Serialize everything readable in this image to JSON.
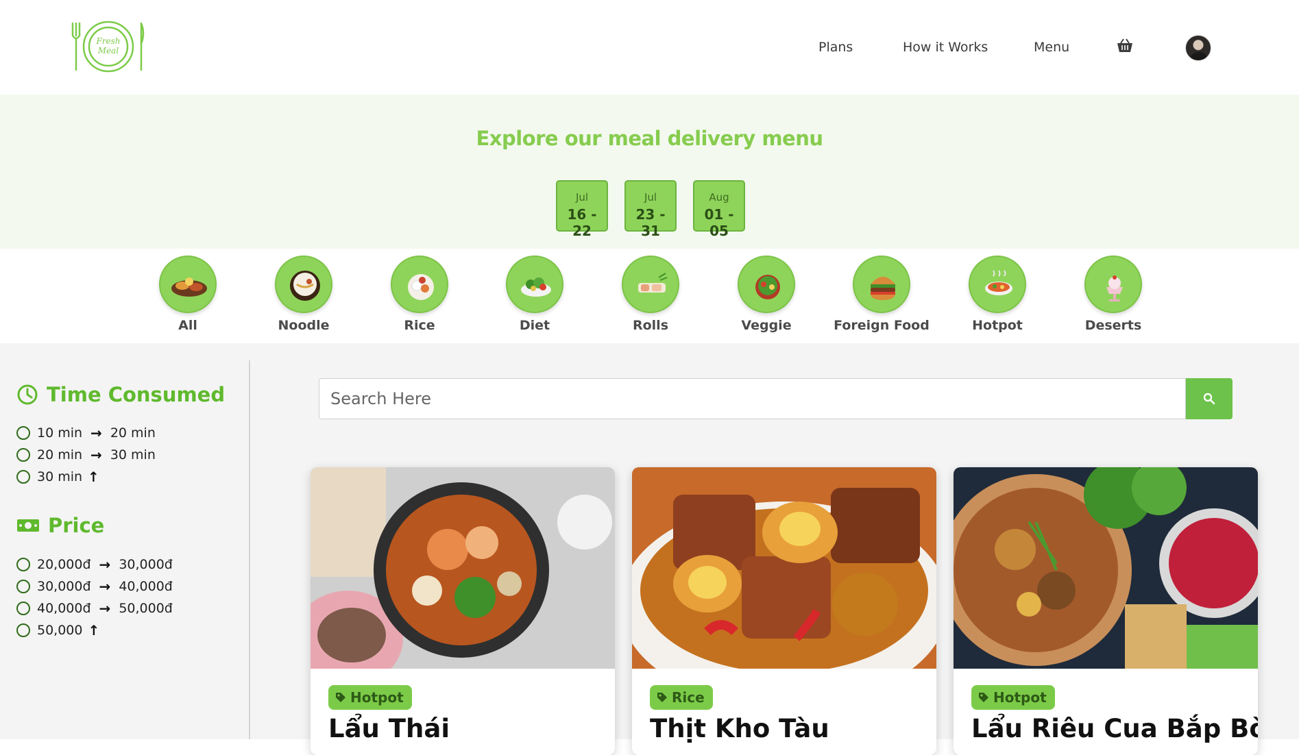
{
  "header": {
    "logo_text_line1": "Fresh",
    "logo_text_line2": "Meal",
    "nav": [
      "Plans",
      "How it Works",
      "Menu"
    ]
  },
  "hero": {
    "title": "Explore our meal delivery menu",
    "weeks": [
      {
        "month": "Jul",
        "days": "16 - 22"
      },
      {
        "month": "Jul",
        "days": "23 - 31"
      },
      {
        "month": "Aug",
        "days": "01 - 05"
      }
    ]
  },
  "categories": [
    "All",
    "Noodle",
    "Rice",
    "Diet",
    "Rolls",
    "Veggie",
    "Foreign Food",
    "Hotpot",
    "Deserts"
  ],
  "filters": {
    "time_title": "Time Consumed",
    "time_options": [
      {
        "from": "10 min",
        "to": "20 min"
      },
      {
        "from": "20 min",
        "to": "30 min"
      },
      {
        "from": "30 min",
        "to": ""
      }
    ],
    "price_title": "Price",
    "price_options": [
      {
        "from": "20,000đ",
        "to": "30,000đ"
      },
      {
        "from": "30,000đ",
        "to": "40,000đ"
      },
      {
        "from": "40,000đ",
        "to": "50,000đ"
      },
      {
        "from": "50,000",
        "to": ""
      }
    ]
  },
  "search": {
    "placeholder": "Search Here"
  },
  "cards": [
    {
      "tag": "Hotpot",
      "name": "Lẩu Thái"
    },
    {
      "tag": "Rice",
      "name": "Thịt Kho Tàu"
    },
    {
      "tag": "Hotpot",
      "name": "Lẩu Riêu Cua Bắp Bò"
    }
  ],
  "colors": {
    "accent": "#86cc4e",
    "tag": "#7ccb48",
    "button": "#6cc24a",
    "hero_bg": "#f3f9ee"
  }
}
